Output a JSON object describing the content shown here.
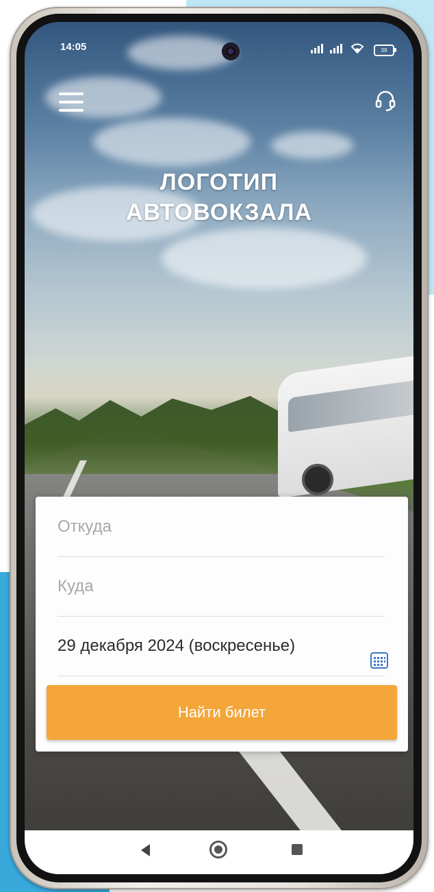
{
  "status_bar": {
    "time": "14:05",
    "signal_1": "atl",
    "signal_2": "atl",
    "wifi_icon": "wifi-icon",
    "battery": "39"
  },
  "header": {
    "menu_icon": "hamburger-menu-icon",
    "support_icon": "headset-icon",
    "logo_line1": "ЛОГОТИП",
    "logo_line2": "АВТОВОКЗАЛА"
  },
  "search_form": {
    "from_placeholder": "Откуда",
    "to_placeholder": "Куда",
    "date_value": "29 декабря 2024 (воскресенье)",
    "calendar_icon": "calendar-icon",
    "submit_label": "Найти билет"
  },
  "nav_bar": {
    "back_icon": "back-triangle-icon",
    "home_icon": "home-circle-icon",
    "recents_icon": "recents-square-icon"
  },
  "colors": {
    "accent": "#F4A63A",
    "card_bg": "#FDFDFD",
    "placeholder": "#A7A7A7",
    "text": "#2B2B2B",
    "calendar_icon": "#3B78C5"
  }
}
